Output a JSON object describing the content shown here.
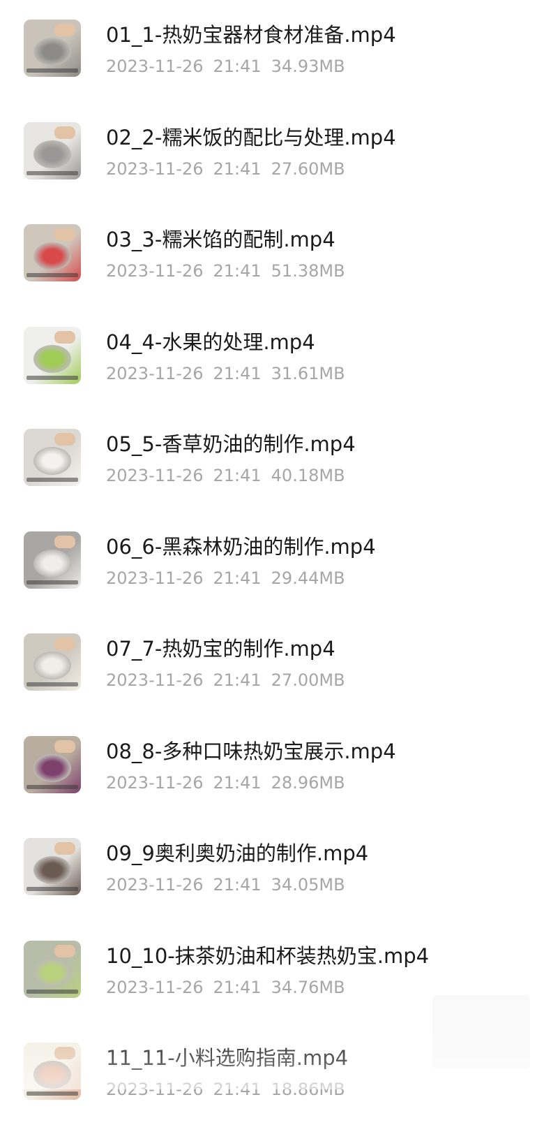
{
  "files": [
    {
      "name": "01_1-热奶宝器材食材准备.mp4",
      "date": "2023-11-26",
      "time": "21:41",
      "size": "34.93MB",
      "thumb_icon": "video-thumbnail",
      "thumb_colors": [
        "#c9c3b9",
        "#8c8a86"
      ]
    },
    {
      "name": "02_2-糯米饭的配比与处理.mp4",
      "date": "2023-11-26",
      "time": "21:41",
      "size": "27.60MB",
      "thumb_icon": "video-thumbnail",
      "thumb_colors": [
        "#e8e6e2",
        "#9a9896"
      ]
    },
    {
      "name": "03_3-糯米馅的配制.mp4",
      "date": "2023-11-26",
      "time": "21:41",
      "size": "51.38MB",
      "thumb_icon": "video-thumbnail",
      "thumb_colors": [
        "#cfc7bc",
        "#d84a4a"
      ]
    },
    {
      "name": "04_4-水果的处理.mp4",
      "date": "2023-11-26",
      "time": "21:41",
      "size": "31.61MB",
      "thumb_icon": "video-thumbnail",
      "thumb_colors": [
        "#efefed",
        "#9fcc55"
      ]
    },
    {
      "name": "05_5-香草奶油的制作.mp4",
      "date": "2023-11-26",
      "time": "21:41",
      "size": "40.18MB",
      "thumb_icon": "video-thumbnail",
      "thumb_colors": [
        "#dcd9d4",
        "#f4f2ee"
      ]
    },
    {
      "name": "06_6-黑森林奶油的制作.mp4",
      "date": "2023-11-26",
      "time": "21:41",
      "size": "29.44MB",
      "thumb_icon": "video-thumbnail",
      "thumb_colors": [
        "#a9a7a3",
        "#efeeea"
      ]
    },
    {
      "name": "07_7-热奶宝的制作.mp4",
      "date": "2023-11-26",
      "time": "21:41",
      "size": "27.00MB",
      "thumb_icon": "video-thumbnail",
      "thumb_colors": [
        "#cfcac0",
        "#f1eee7"
      ]
    },
    {
      "name": "08_8-多种口味热奶宝展示.mp4",
      "date": "2023-11-26",
      "time": "21:41",
      "size": "28.96MB",
      "thumb_icon": "video-thumbnail",
      "thumb_colors": [
        "#b9ada0",
        "#7d3f6b"
      ]
    },
    {
      "name": "09_9奥利奥奶油的制作.mp4",
      "date": "2023-11-26",
      "time": "21:41",
      "size": "34.05MB",
      "thumb_icon": "video-thumbnail",
      "thumb_colors": [
        "#e4e2df",
        "#6b5a52"
      ]
    },
    {
      "name": "10_10-抹茶奶油和杯装热奶宝.mp4",
      "date": "2023-11-26",
      "time": "21:41",
      "size": "34.76MB",
      "thumb_icon": "video-thumbnail",
      "thumb_colors": [
        "#b8bda9",
        "#b9d27e"
      ]
    },
    {
      "name": "11_11-小料选购指南.mp4",
      "date": "2023-11-26",
      "time": "21:41",
      "size": "18.86MB",
      "thumb_icon": "video-thumbnail",
      "thumb_colors": [
        "#f3efe4",
        "#e6b9a1"
      ]
    }
  ]
}
